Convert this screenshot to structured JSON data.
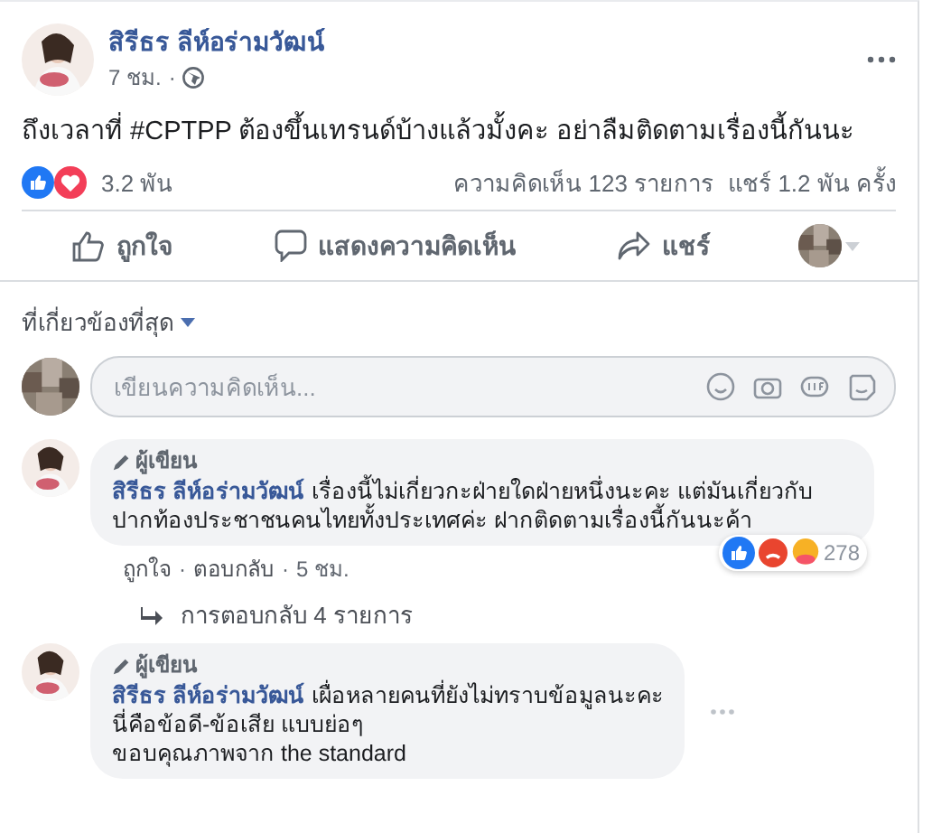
{
  "post": {
    "author": "สิรีธร ลีห์อร่ามวัฒน์",
    "time": "7 ชม.",
    "text": "ถึงเวลาที่ #CPTPP ต้องขึ้นเทรนด์บ้างแล้วมั้งคะ อย่าลืมติดตามเรื่องนี้กันนะ",
    "reaction_count": "3.2 พัน",
    "comment_count": "ความคิดเห็น 123 รายการ",
    "share_count": "แชร์ 1.2 พัน ครั้ง"
  },
  "actions": [
    {
      "kind": "like",
      "label": "ถูกใจ"
    },
    {
      "kind": "comment",
      "label": "แสดงความคิดเห็น"
    },
    {
      "kind": "share",
      "label": "แชร์"
    }
  ],
  "separator": "·",
  "sort": "ที่เกี่ยวข้องที่สุด",
  "comment_box": {
    "placeholder": "เขียนความคิดเห็น..."
  },
  "comments": [
    {
      "badge": "ผู้เขียน",
      "author": "สิรีธร ลีห์อร่ามวัฒน์",
      "text": "เรื่องนี้ไม่เกี่ยวกะฝ่ายใดฝ่ายหนึ่งนะคะ แต่มันเกี่ยวกับปากท้องประชาชนคนไทยทั้งประเทศค่ะ ฝากติดตามเรื่องนี้กันนะค้า",
      "reaction_count": "278",
      "like": "ถูกใจ",
      "reply": "ตอบกลับ",
      "time": "5 ชม.",
      "replies": "การตอบกลับ 4 รายการ"
    },
    {
      "badge": "ผู้เขียน",
      "author": "สิรีธร ลีห์อร่ามวัฒน์",
      "text": "เผื่อหลายคนที่ยังไม่ทราบข้อมูลนะคะ\nนี่คือข้อดี-ข้อเสีย แบบย่อๆ\nขอบคุณภาพจาก the standard"
    }
  ]
}
